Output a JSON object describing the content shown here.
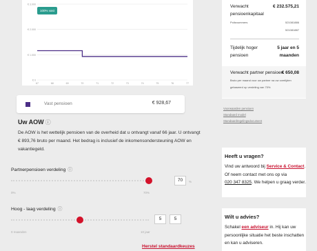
{
  "chart": {
    "badge": "100% vast",
    "y_ticks": [
      "€ 3.000",
      "€ 2.000",
      "€ 1.000",
      "€ 0"
    ],
    "x_ticks": [
      "67",
      "68",
      "69",
      "70",
      "71",
      "72",
      "73",
      "74",
      "75",
      "76",
      "77"
    ],
    "line_color": "#4b2e86"
  },
  "chart_data": {
    "type": "line",
    "x": [
      67,
      68,
      69,
      70,
      71,
      72,
      73,
      74,
      75,
      76,
      77
    ],
    "series": [
      {
        "name": "Vast pensioen",
        "values": [
          1160,
          1160,
          1160,
          929,
          929,
          929,
          929,
          929,
          929,
          929,
          929
        ]
      }
    ],
    "ylim": [
      0,
      3000
    ],
    "grid": true
  },
  "legend": {
    "label": "Vast pensioen",
    "amount": "€ 928,67",
    "color": "#4b2e86"
  },
  "aow": {
    "title": "Uw AOW",
    "text": "De AOW is het wettelijk pensioen van de overheid dat u ontvangt vanaf 66 jaar. U ontvangt € 893,76 bruto per maand. Het bedrag is inclusief de inkomensondersteuning AOW en vakantiegeld."
  },
  "sliders": {
    "partner": {
      "label": "Partnerpensioen verdeling",
      "value": "70",
      "unit": "%",
      "min_label": "0%",
      "max_label": "70%",
      "level": 1.0
    },
    "hooglaag": {
      "label": "Hoog - laag verdeling",
      "value_a": "5",
      "value_b": "5",
      "min_label": "0 maanden",
      "max_label": "10 jaar",
      "level": 0.5
    }
  },
  "reset_label": "Herstel standaardkeuzes",
  "summary": {
    "verwacht_label_1": "Verwacht",
    "verwacht_label_2": "pensioenkapitaal",
    "verwacht_amount": "€ 232.575,21",
    "polis_label": "Polisnummers",
    "polis_1": "521081886",
    "polis_2": "521081887",
    "tijdelijk_label_1": "Tijdelijk hoger",
    "tijdelijk_label_2": "pensioen",
    "tijdelijk_value_1": "5 jaar en 5",
    "tijdelijk_value_2": "maanden",
    "partner_label": "Verwacht partner pensioen",
    "partner_amount": "€ 650,08",
    "partner_note_1": "Bruto per maand voor uw partner na uw overlijden",
    "partner_note_2": "gebaseerd op verdeling van 70%"
  },
  "links": [
    "Voorwaarden pensioen",
    "Standaard model",
    "Standaardregelingsdocument"
  ],
  "help": {
    "title": "Heeft u vragen?",
    "line1": "Vind uw antwoord bij",
    "link": "Service & Contact",
    "line2": "Of neem contact met ons op via",
    "phone": "020 347 8325",
    "line3": ". We helpen u graag verder."
  },
  "advice": {
    "title": "Wilt u advies?",
    "pre": "Schakel",
    "link": "een adviseur",
    "post": "in. Hij kan uw persoonlijke situatie het beste inschatten en kan u adviseren."
  }
}
